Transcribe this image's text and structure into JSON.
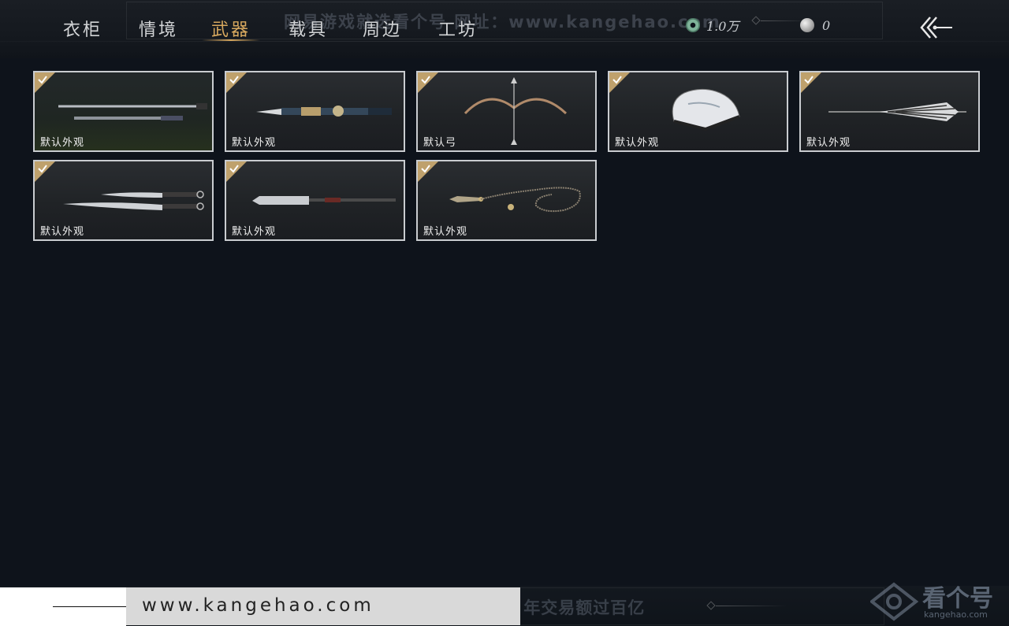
{
  "header": {
    "tabs": [
      {
        "label": "衣柜",
        "active": false
      },
      {
        "label": "情境",
        "active": false
      },
      {
        "label": "武器",
        "active": true
      },
      {
        "label": "载具",
        "active": false
      },
      {
        "label": "周边",
        "active": false
      },
      {
        "label": "工坊",
        "active": false
      }
    ],
    "watermark": "网易游戏就选看个号  网址：www.kangehao.com",
    "currency_jade": "1.0万",
    "currency_silver": "0",
    "back_icon": "double-chevron-left-arrow-icon"
  },
  "weapons": [
    {
      "label": "默认外观",
      "art": "sword-pair"
    },
    {
      "label": "默认外观",
      "art": "ornate-spear"
    },
    {
      "label": "默认弓",
      "art": "bow"
    },
    {
      "label": "默认外观",
      "art": "folding-fan"
    },
    {
      "label": "默认外观",
      "art": "umbrella"
    },
    {
      "label": "默认外观",
      "art": "dual-blades"
    },
    {
      "label": "默认外观",
      "art": "glaive"
    },
    {
      "label": "默认外观",
      "art": "rope-dart"
    }
  ],
  "footer": {
    "url": "www.kangehao.com",
    "watermark": "看个号专业网易游戏八年  年交易额过百亿",
    "brand": "看个号",
    "brand_sub": "kangehao.com"
  },
  "colors": {
    "background": "#0e131b",
    "active_tab": "#d7a85e",
    "card_border": "#c9ccd0",
    "check_badge": "#bfa16c"
  }
}
